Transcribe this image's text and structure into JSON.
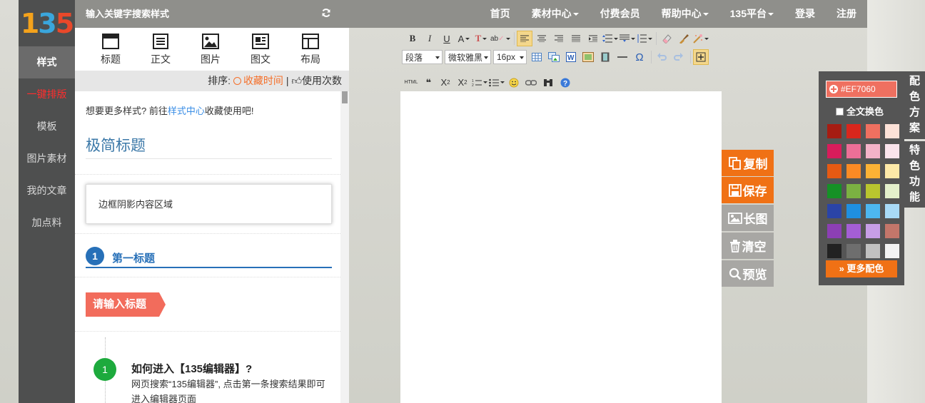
{
  "leftnav": {
    "logo_chars": [
      "1",
      "3",
      "5"
    ],
    "items": [
      {
        "label": "样式",
        "active": true
      },
      {
        "label": "一键排版",
        "red": true
      },
      {
        "label": "模板"
      },
      {
        "label": "图片素材"
      },
      {
        "label": "我的文章"
      },
      {
        "label": "加点料"
      }
    ]
  },
  "topbar": {
    "search_text": "输入关键字搜索样式",
    "nav": [
      "首页",
      "素材中心",
      "付费会员",
      "帮助中心",
      "135平台",
      "登录",
      "注册"
    ]
  },
  "categories": [
    "标题",
    "正文",
    "图片",
    "图文",
    "布局"
  ],
  "sort": {
    "label": "排序:",
    "option1": "收藏时间",
    "divider": "|",
    "option2": "使用次数"
  },
  "styles": {
    "tip_prefix": "想要更多样式? 前往",
    "tip_link": "样式中心",
    "tip_suffix": "收藏使用吧!",
    "minimal_title": "极简标题",
    "shadow_box": "边框阴影内容区域",
    "first_num": "1",
    "first_title": "第一标题",
    "tag_title": "请输入标题",
    "step_num": "1",
    "step_title": "如何进入【135编辑器】?",
    "step_desc": "网页搜索“135编辑器”, 点击第一条搜索结果即可进入编辑器页面"
  },
  "toolbar": {
    "bold": "B",
    "italic": "I",
    "underline": "U",
    "font_color": "A",
    "paragraph": "段落",
    "font": "微软雅黑",
    "size": "16px",
    "omega": "Ω",
    "html": "HTML",
    "quote": "66",
    "sup": "X",
    "sub": "X"
  },
  "actions": [
    "复制",
    "保存",
    "长图",
    "清空",
    "预览"
  ],
  "colors": {
    "current": "#EF7060",
    "full_label": "全文换色",
    "more_label": "更多配色",
    "swatches": [
      [
        "#a61c12",
        "#d9261c",
        "#ef7060",
        "#fde2d8"
      ],
      [
        "#d81c5b",
        "#ec6f97",
        "#f4b3c8",
        "#fbe4ec"
      ],
      [
        "#e65a13",
        "#fb8a24",
        "#fbb235",
        "#fde9a8"
      ],
      [
        "#159126",
        "#7bb142",
        "#b9c52e",
        "#e4f0cb"
      ],
      [
        "#2a44a7",
        "#1f8fe0",
        "#4db7ef",
        "#a8daf6"
      ],
      [
        "#8c3fb4",
        "#a45ed5",
        "#c79ee6",
        "#c3766a"
      ],
      [
        "#222222",
        "#6e6e6e",
        "#c1c1c1",
        "#f3f3f3"
      ]
    ]
  },
  "side_tabs": [
    "配色方案",
    "特色功能"
  ]
}
